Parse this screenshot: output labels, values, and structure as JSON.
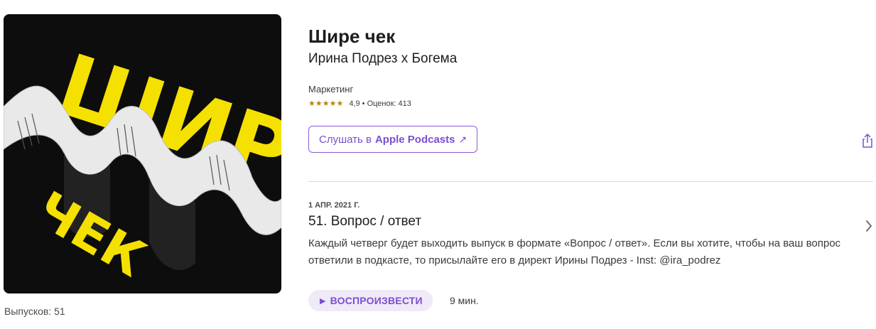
{
  "podcast": {
    "title": "Шире чек",
    "author": "Ирина Подрез x Богема",
    "category": "Маркетинг",
    "stars": "★★★★★",
    "rating": "4,9 • Оценок: 413",
    "episode_count": "Выпусков: 51"
  },
  "artwork": {
    "title_word": "ШИРЕ",
    "subtitle_word": "ЧЕК",
    "accent_color": "#f5e100",
    "background_color": "#0d0d0d"
  },
  "actions": {
    "listen_prefix": "Слушать в",
    "listen_strong": "Apple Podcasts",
    "listen_arrow": "↗",
    "share_icon": "share-icon"
  },
  "episode": {
    "date": "1 АПР. 2021 Г.",
    "title": "51. Вопрос / ответ",
    "description": "Каждый четверг будет выходить выпуск в формате «Вопрос / ответ». Если вы хотите, чтобы на ваш вопрос ответили в подкасте, то присылайте его в директ Ирины Подрез - Inst: @ira_podrez",
    "play_label": "ВОСПРОИЗВЕСТИ",
    "duration": "9 мин."
  },
  "colors": {
    "accent": "#7b4fcf",
    "star": "#b8860b"
  }
}
